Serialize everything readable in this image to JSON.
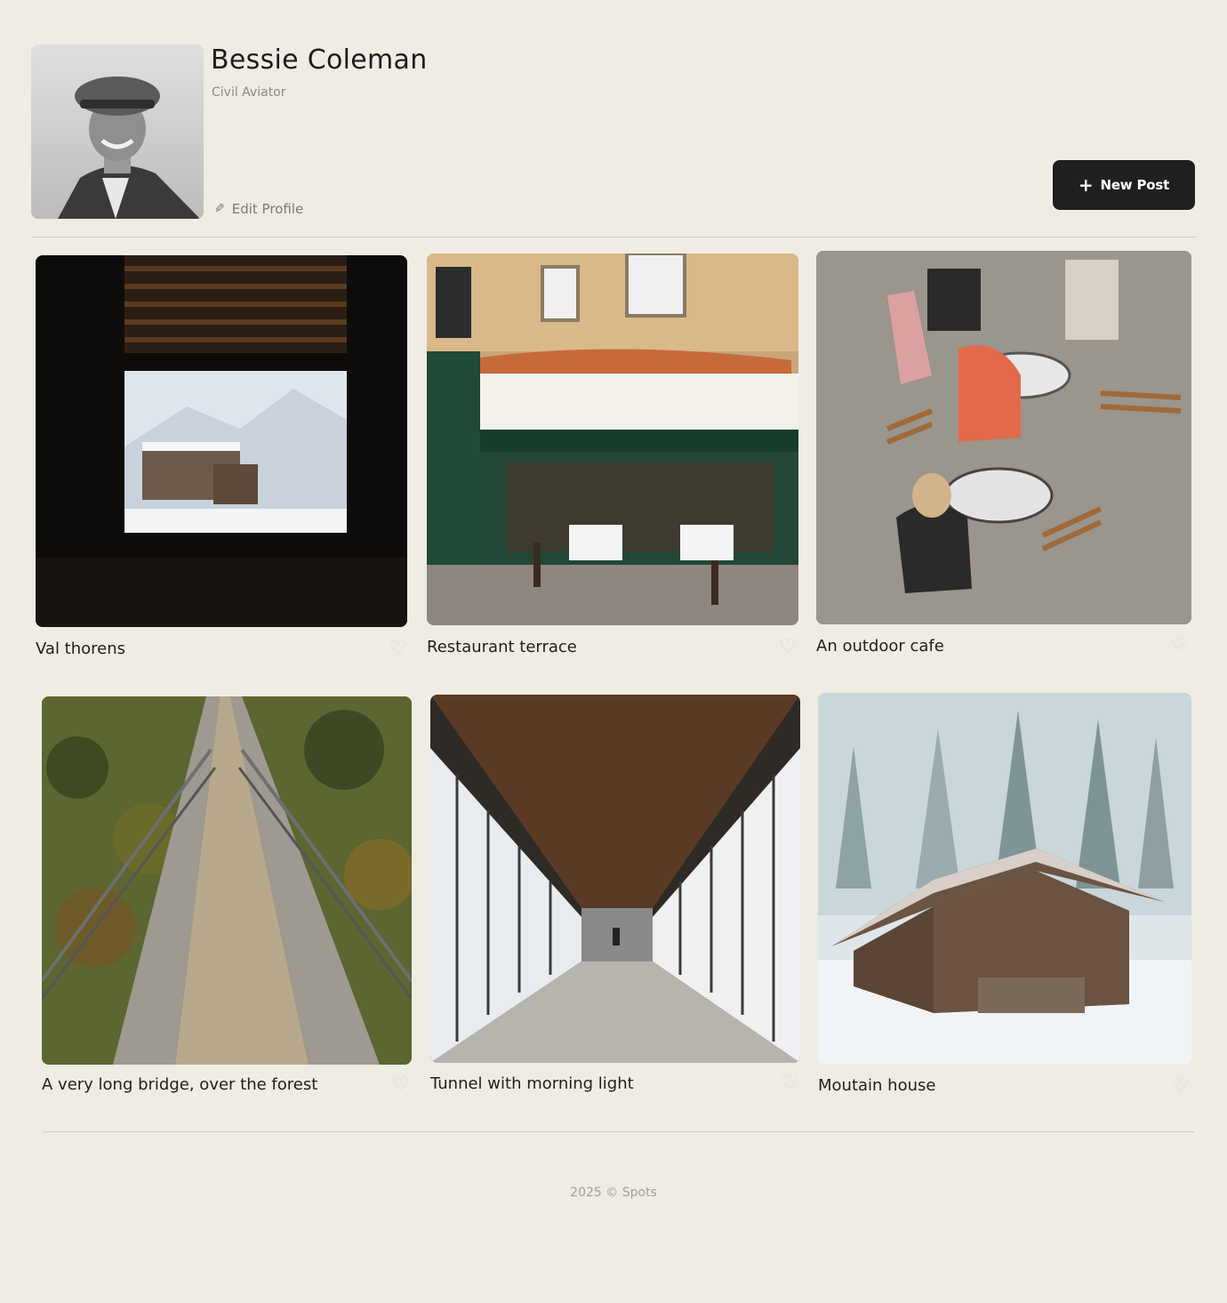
{
  "profile": {
    "name": "Bessie Coleman",
    "description": "Civil Aviator",
    "edit_label": "Edit Profile",
    "avatar_alt": "avatar-photo"
  },
  "toolbar": {
    "new_post_label": "New Post",
    "new_post_icon": "+"
  },
  "cards": [
    {
      "title": "Val thorens",
      "liked": false,
      "image": "window-snow-view"
    },
    {
      "title": "Restaurant terrace",
      "liked": false,
      "image": "paris-restaurant"
    },
    {
      "title": "An outdoor cafe",
      "liked": false,
      "image": "outdoor-cafe"
    },
    {
      "title": "A very long bridge, over the forest",
      "liked": false,
      "image": "suspension-bridge"
    },
    {
      "title": "Tunnel with morning light",
      "liked": false,
      "image": "glass-tunnel"
    },
    {
      "title": "Moutain house",
      "liked": false,
      "image": "snow-cabin"
    }
  ],
  "heart_glyph": "♡",
  "footer": {
    "text": "2025 © Spots"
  },
  "colors": {
    "background": "#efece4",
    "button": "#1f1f1f",
    "muted_text": "#8c8a85"
  }
}
